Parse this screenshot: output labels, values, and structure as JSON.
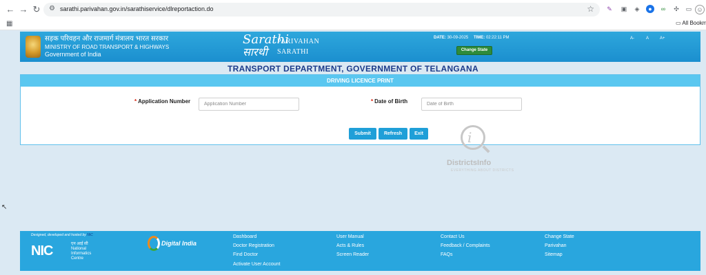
{
  "browser": {
    "url": "sarathi.parivahan.gov.in/sarathiservice/dlreportaction.do",
    "all_bookmarks": "All Bookma"
  },
  "header": {
    "ministry_hindi": "सड़क परिवहन और राजमार्ग मंत्रालय भारत सरकार",
    "ministry_english": "MINISTRY OF ROAD TRANSPORT & HIGHWAYS",
    "government": "Government of India",
    "logo_sarathi": "Sarathi",
    "logo_sarathi_hindi": "सारथी",
    "logo_parivahan": "PARIVAHAN",
    "logo_sarathi_text": "SARATHI",
    "date_label": "DATE:",
    "date_value": "30-09-2025",
    "time_label": "TIME:",
    "time_value": "02:22:11 PM",
    "change_state": "Change State",
    "font_sizes": [
      "A-",
      "A",
      "A+"
    ]
  },
  "department_title": "TRANSPORT DEPARTMENT, GOVERNMENT OF TELANGANA",
  "form": {
    "panel_title": "DRIVING LICENCE PRINT",
    "required_mark": "*",
    "application_number_label": "Application Number",
    "application_number_placeholder": "Application Number",
    "application_number_value": "",
    "dob_label": "Date of Birth",
    "dob_placeholder": "Date of Birth",
    "dob_value": "",
    "submit": "Submit",
    "refresh": "Refresh",
    "exit": "Exit"
  },
  "watermark": {
    "text": "DistrictsInfo",
    "sub": "EVERYTHING ABOUT DISTRICTS"
  },
  "footer": {
    "designed_by": "Designed, developed and hosted by",
    "nic_link": "NIC",
    "nic_logo": "NIC",
    "nic_hindi": "एन आई सी",
    "nic_name_1": "National",
    "nic_name_2": "Informatics",
    "nic_name_3": "Centre",
    "digital_india": "Digital India",
    "links": {
      "dashboard": "Dashboard",
      "doctor_registration": "Doctor Registration",
      "find_doctor": "Find Doctor",
      "activate_user_account": "Activate User Account",
      "user_manual": "User Manual",
      "acts_rules": "Acts & Rules",
      "screen_reader": "Screen Reader",
      "contact_us": "Contact Us",
      "feedback_complaints": "Feedback / Complaints",
      "faqs": "FAQs",
      "change_state": "Change State",
      "parivahan": "Parivahan",
      "sitemap": "Sitemap"
    }
  },
  "colors": {
    "header_blue": "#1b8fcf",
    "panel_head": "#5ac7f0",
    "button_blue": "#1f9fd8",
    "change_state_green": "#2e8b3a",
    "title_navy": "#1b3a8a",
    "required_red": "#d9230f"
  }
}
